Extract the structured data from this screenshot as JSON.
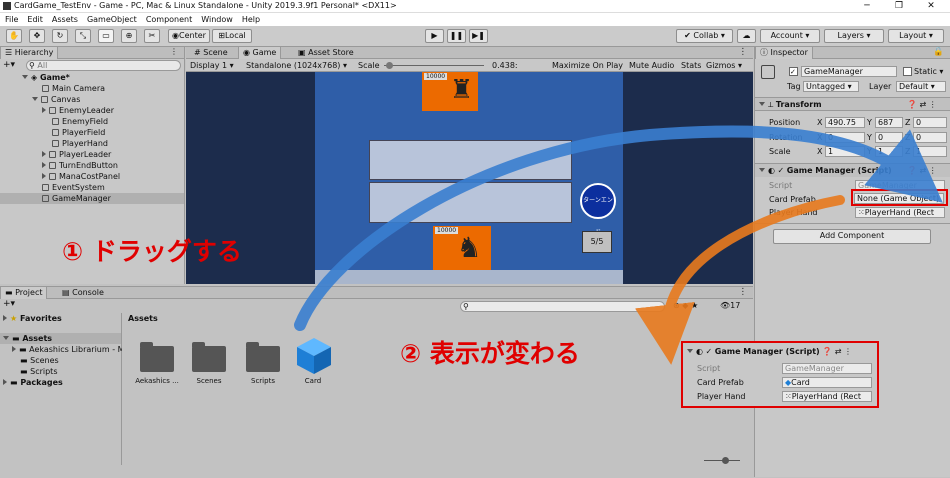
{
  "window": {
    "title": "CardGame_TestEnv - Game - PC, Mac & Linux Standalone - Unity 2019.3.9f1 Personal* <DX11>",
    "minimize": "─",
    "maximize": "❐",
    "close": "✕"
  },
  "menu": [
    "File",
    "Edit",
    "Assets",
    "GameObject",
    "Component",
    "Window",
    "Help"
  ],
  "toolbar": {
    "center": "Center",
    "local": "Local",
    "collab": "Collab ▾",
    "account": "Account ▾",
    "layers": "Layers ▾",
    "layout": "Layout ▾"
  },
  "hierarchy": {
    "tab": "Hierarchy",
    "search": "All",
    "scene": "Game*",
    "items": [
      "Main Camera",
      "Canvas",
      "EnemyLeader",
      "EnemyField",
      "PlayerField",
      "PlayerHand",
      "PlayerLeader",
      "TurnEndButton",
      "ManaCostPanel",
      "EventSystem",
      "GameManager"
    ]
  },
  "game": {
    "tabs": [
      "Scene",
      "Game",
      "Asset Store"
    ],
    "display": "Display 1",
    "resolution": "Standalone (1024x768)",
    "scale_label": "Scale",
    "scale_value": "0.438:",
    "maximize": "Maximize On Play",
    "mute": "Mute Audio",
    "stats": "Stats",
    "gizmos": "Gizmos",
    "enemy_hp": "10000",
    "player_hp": "10000",
    "turn_end": "ターンエンド",
    "mana": "5/5"
  },
  "inspector": {
    "tab": "Inspector",
    "object_name": "GameManager",
    "static_label": "Static",
    "tag_label": "Tag",
    "tag_value": "Untagged",
    "layer_label": "Layer",
    "layer_value": "Default",
    "transform": "Transform",
    "position_label": "Position",
    "rotation_label": "Rotation",
    "scale_label": "Scale",
    "pos_x": "490.75",
    "pos_y": "687",
    "pos_z": "0",
    "rot_x": "0",
    "rot_y": "0",
    "rot_z": "0",
    "scl_x": "1",
    "scl_y": "1",
    "scl_z": "1",
    "component": "Game Manager (Script)",
    "script_label": "Script",
    "script_value": "GameManager",
    "card_prefab_label": "Card Prefab",
    "card_prefab_value": "None (Game Object)",
    "player_hand_label": "Player Hand",
    "player_hand_value": "PlayerHand (Rect",
    "add_component": "Add Component"
  },
  "project": {
    "tabs": [
      "Project",
      "Console"
    ],
    "favorites": "Favorites",
    "assets": "Assets",
    "tree": [
      "Aekashics Librarium - M",
      "Scenes",
      "Scripts"
    ],
    "packages": "Packages",
    "breadcrumb": "Assets",
    "hidden_count": "17",
    "items": [
      "Aekashics ...",
      "Scenes",
      "Scripts",
      "Card"
    ]
  },
  "callout": {
    "component": "Game Manager (Script)",
    "script_label": "Script",
    "script_value": "GameManager",
    "card_prefab_label": "Card Prefab",
    "card_prefab_value": "Card",
    "player_hand_label": "Player Hand",
    "player_hand_value": "PlayerHand (Rect"
  },
  "annotations": {
    "step1": "① ドラッグする",
    "step2": "② 表示が変わる"
  },
  "colors": {
    "highlight": "#e00000",
    "arrow_blue": "#3a7fd0",
    "arrow_orange": "#e87a1e",
    "game_bg": "#1c2c4c",
    "board_blue": "#2f5ea8",
    "card_orange": "#ec6a00"
  }
}
